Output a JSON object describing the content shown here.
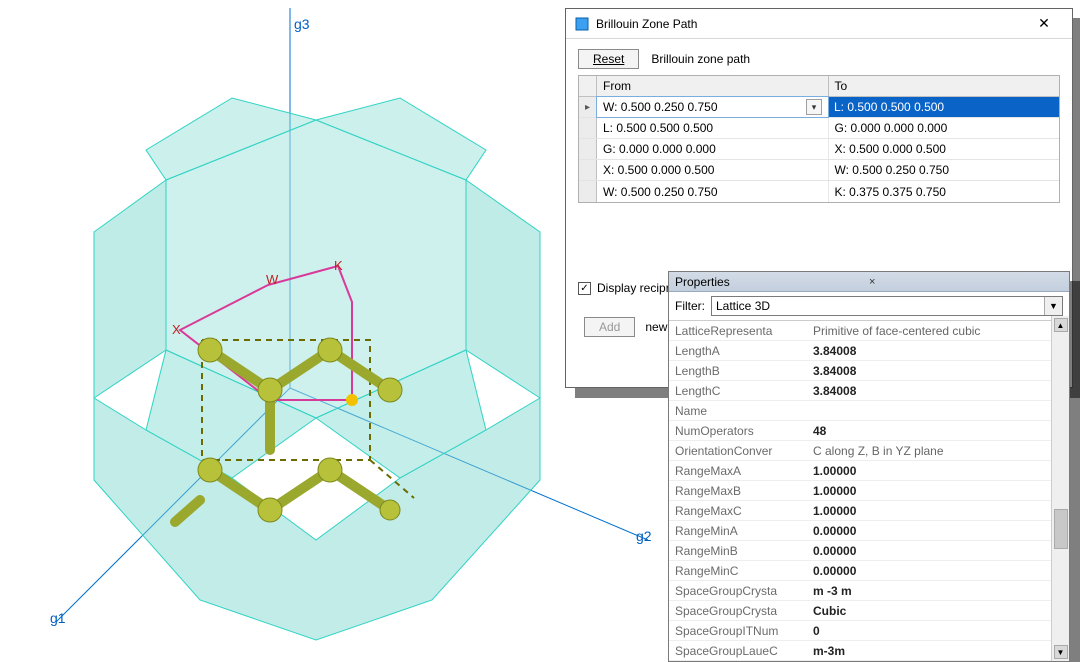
{
  "viewport": {
    "axes": {
      "g1": "g1",
      "g2": "g2",
      "g3": "g3"
    },
    "kpoints": {
      "W": "W",
      "K": "K",
      "X": "X"
    }
  },
  "bz_dialog": {
    "title": "Brillouin Zone Path",
    "reset_label": "Reset",
    "caption": "Brillouin zone path",
    "col_from": "From",
    "col_to": "To",
    "rows": [
      {
        "from": "W: 0.500 0.250 0.750",
        "to": "L: 0.500 0.500 0.500"
      },
      {
        "from": "L: 0.500 0.500 0.500",
        "to": "G: 0.000 0.000 0.000"
      },
      {
        "from": "G: 0.000 0.000 0.000",
        "to": "X: 0.500 0.000 0.500"
      },
      {
        "from": "X: 0.500 0.000 0.500",
        "to": "W: 0.500 0.250 0.750"
      },
      {
        "from": "W: 0.500 0.250 0.750",
        "to": "K: 0.375 0.375 0.750"
      }
    ],
    "display_checkbox": "Display reciprocal lattice",
    "add_label": "Add",
    "new_label": "new"
  },
  "props": {
    "title": "Properties",
    "filter_label": "Filter:",
    "filter_value": "Lattice 3D",
    "rows": [
      {
        "k": "LatticeRepresenta",
        "v": "Primitive of face-centered cubic"
      },
      {
        "k": "LengthA",
        "v": "3.84008"
      },
      {
        "k": "LengthB",
        "v": "3.84008"
      },
      {
        "k": "LengthC",
        "v": "3.84008"
      },
      {
        "k": "Name",
        "v": ""
      },
      {
        "k": "NumOperators",
        "v": "48"
      },
      {
        "k": "OrientationConver",
        "v": "C along Z, B in YZ plane"
      },
      {
        "k": "RangeMaxA",
        "v": "1.00000"
      },
      {
        "k": "RangeMaxB",
        "v": "1.00000"
      },
      {
        "k": "RangeMaxC",
        "v": "1.00000"
      },
      {
        "k": "RangeMinA",
        "v": "0.00000"
      },
      {
        "k": "RangeMinB",
        "v": "0.00000"
      },
      {
        "k": "RangeMinC",
        "v": "0.00000"
      },
      {
        "k": "SpaceGroupCrysta",
        "v": "m -3 m"
      },
      {
        "k": "SpaceGroupCrysta",
        "v": "Cubic"
      },
      {
        "k": "SpaceGroupITNum",
        "v": "0"
      },
      {
        "k": "SpaceGroupLaueC",
        "v": "m-3m"
      }
    ]
  }
}
